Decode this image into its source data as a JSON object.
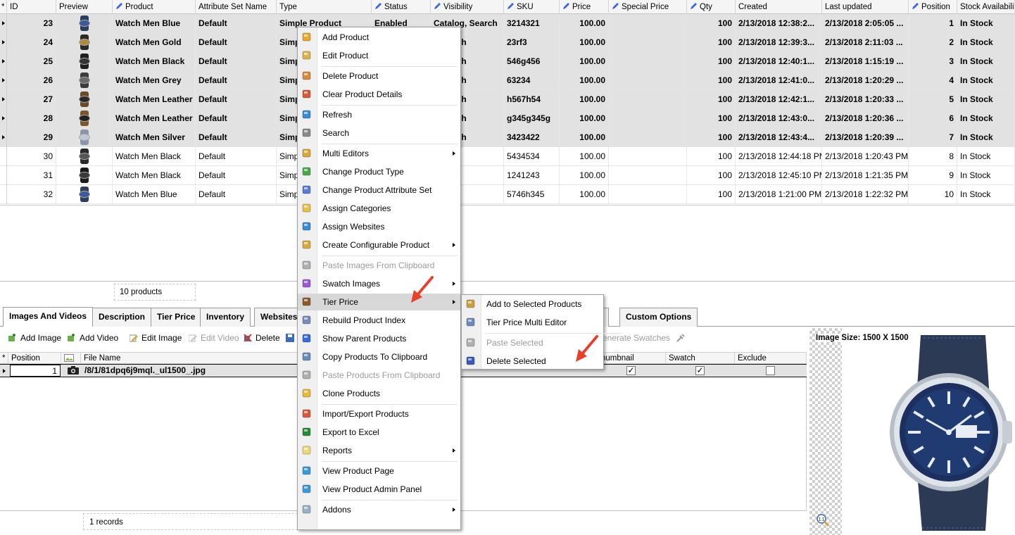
{
  "grid": {
    "columns": [
      {
        "label": "ID",
        "icon": "asterisk"
      },
      {
        "label": "Preview"
      },
      {
        "label": "Product",
        "icon": "pencil"
      },
      {
        "label": "Attribute Set Name"
      },
      {
        "label": "Type"
      },
      {
        "label": "Status",
        "icon": "pencil"
      },
      {
        "label": "Visibility",
        "icon": "pencil"
      },
      {
        "label": "SKU",
        "icon": "pencil"
      },
      {
        "label": "Price",
        "icon": "pencil"
      },
      {
        "label": "Special Price",
        "icon": "pencil"
      },
      {
        "label": "Qty",
        "icon": "pencil"
      },
      {
        "label": "Created"
      },
      {
        "label": "Last updated"
      },
      {
        "label": "Position",
        "icon": "pencil"
      },
      {
        "label": "Stock Availability"
      }
    ],
    "rows": [
      {
        "id": "23",
        "product": "Watch Men Blue",
        "attr": "Default",
        "type": "Simple Product",
        "status": "Enabled",
        "visibility": "Catalog, Search",
        "sku": "3214321",
        "price": "100.00",
        "special": "",
        "qty": "100",
        "created": "2/13/2018 12:38:2...",
        "updated": "2/13/2018 2:05:05 ...",
        "position": "1",
        "stock": "In Stock",
        "selected": true,
        "strap": "#2c3e5c",
        "face": "#3a5a9a"
      },
      {
        "id": "24",
        "product": "Watch Men Gold",
        "attr": "Default",
        "type": "Simp",
        "status": "",
        "visibility": ", Search",
        "sku": "23rf3",
        "price": "100.00",
        "special": "",
        "qty": "100",
        "created": "2/13/2018 12:39:3...",
        "updated": "2/13/2018 2:11:03 ...",
        "position": "2",
        "stock": "In Stock",
        "selected": true,
        "strap": "#2a2a2a",
        "face": "#b08a3e"
      },
      {
        "id": "25",
        "product": "Watch Men Black",
        "attr": "Default",
        "type": "Simp",
        "status": "",
        "visibility": ", Search",
        "sku": "546g456",
        "price": "100.00",
        "special": "",
        "qty": "100",
        "created": "2/13/2018 12:40:1...",
        "updated": "2/13/2018 1:15:19 ...",
        "position": "3",
        "stock": "In Stock",
        "selected": true,
        "strap": "#1e1e1e",
        "face": "#333333"
      },
      {
        "id": "26",
        "product": "Watch Men Grey",
        "attr": "Default",
        "type": "Simp",
        "status": "",
        "visibility": ", Search",
        "sku": "63234",
        "price": "100.00",
        "special": "",
        "qty": "100",
        "created": "2/13/2018 12:41:0...",
        "updated": "2/13/2018 1:20:29 ...",
        "position": "4",
        "stock": "In Stock",
        "selected": true,
        "strap": "#3b3b3b",
        "face": "#6a6a6a"
      },
      {
        "id": "27",
        "product": "Watch Men Leather",
        "attr": "Default",
        "type": "Simp",
        "status": "",
        "visibility": ", Search",
        "sku": "h567h54",
        "price": "100.00",
        "special": "",
        "qty": "100",
        "created": "2/13/2018 12:42:1...",
        "updated": "2/13/2018 1:20:33 ...",
        "position": "5",
        "stock": "In Stock",
        "selected": true,
        "strap": "#6b4a2a",
        "face": "#2a2a2a"
      },
      {
        "id": "28",
        "product": "Watch Men Leather",
        "attr": "Default",
        "type": "Simp",
        "status": "",
        "visibility": ", Search",
        "sku": "g345g345g",
        "price": "100.00",
        "special": "",
        "qty": "100",
        "created": "2/13/2018 12:43:0...",
        "updated": "2/13/2018 1:20:36 ...",
        "position": "6",
        "stock": "In Stock",
        "selected": true,
        "strap": "#7a5530",
        "face": "#222222"
      },
      {
        "id": "29",
        "product": "Watch Men Silver",
        "attr": "Default",
        "type": "Simp",
        "status": "",
        "visibility": ", Search",
        "sku": "3423422",
        "price": "100.00",
        "special": "",
        "qty": "100",
        "created": "2/13/2018 12:43:4...",
        "updated": "2/13/2018 1:20:39 ...",
        "position": "7",
        "stock": "In Stock",
        "selected": true,
        "strap": "#8a95a8",
        "face": "#c0c8d4"
      },
      {
        "id": "30",
        "product": "Watch Men Black",
        "attr": "Default",
        "type": "Simpl",
        "status": "",
        "visibility": "Search",
        "sku": "5434534",
        "price": "100.00",
        "special": "",
        "qty": "100",
        "created": "2/13/2018 12:44:18 PM",
        "updated": "2/13/2018 1:20:43 PM",
        "position": "8",
        "stock": "In Stock",
        "selected": false,
        "strap": "#2a2a2a",
        "face": "#555555"
      },
      {
        "id": "31",
        "product": "Watch Men Black",
        "attr": "Default",
        "type": "Simpl",
        "status": "",
        "visibility": "Search",
        "sku": "1241243",
        "price": "100.00",
        "special": "",
        "qty": "100",
        "created": "2/13/2018 12:45:10 PM",
        "updated": "2/13/2018 1:21:35 PM",
        "position": "9",
        "stock": "In Stock",
        "selected": false,
        "strap": "#1a1a1a",
        "face": "#3a3a3a"
      },
      {
        "id": "32",
        "product": "Watch Men Blue",
        "attr": "Default",
        "type": "Simpl",
        "status": "",
        "visibility": "Search",
        "sku": "5746h345",
        "price": "100.00",
        "special": "",
        "qty": "100",
        "created": "2/13/2018 1:21:00 PM",
        "updated": "2/13/2018 1:22:32 PM",
        "position": "10",
        "stock": "In Stock",
        "selected": false,
        "strap": "#2c3e5c",
        "face": "#3a5a9a"
      }
    ],
    "count_label": "10 products"
  },
  "tabs": [
    {
      "label": "Images And Videos",
      "active": true
    },
    {
      "label": "Description"
    },
    {
      "label": "Tier Price"
    },
    {
      "label": "Inventory"
    },
    {
      "label": "Websites"
    },
    {
      "label": "ws"
    },
    {
      "label": "Custom Options"
    }
  ],
  "toolbar": {
    "add_image": "Add Image",
    "add_video": "Add Video",
    "edit_image": "Edit Image",
    "edit_video": "Edit Video",
    "delete": "Delete",
    "generate_swatches": "enerate Swatches"
  },
  "subgrid": {
    "columns": [
      "Position",
      "",
      "File Name",
      "humbnail",
      "Swatch",
      "Exclude"
    ],
    "row": {
      "position": "1",
      "file": "/8/1/81dpq6j9mql._ul1500_.jpg"
    },
    "records_label": "1 records"
  },
  "preview": {
    "image_size": "Image Size: 1500 X 1500",
    "zoom_label": "1:1"
  },
  "context_menu": [
    {
      "label": "Add Product",
      "icon": "add-product-icon",
      "color": "#e8a82a"
    },
    {
      "label": "Edit Product",
      "icon": "edit-product-icon",
      "color": "#d8b44a"
    },
    {
      "sep": true
    },
    {
      "label": "Delete Product",
      "icon": "delete-product-icon",
      "color": "#d88a3a"
    },
    {
      "label": "Clear Product Details",
      "icon": "clear-details-icon",
      "color": "#d45a3a"
    },
    {
      "sep": true
    },
    {
      "label": "Refresh",
      "icon": "refresh-icon",
      "color": "#3a8ad8"
    },
    {
      "label": "Search",
      "icon": "search-icon",
      "color": "#8a8a8a"
    },
    {
      "sep": true
    },
    {
      "label": "Multi Editors",
      "icon": "multi-editors-icon",
      "color": "#d8a83a",
      "submenu": true
    },
    {
      "label": "Change Product Type",
      "icon": "change-type-icon",
      "color": "#4aa84a"
    },
    {
      "label": "Change Product Attribute Set",
      "icon": "attribute-set-icon",
      "color": "#5a7ad8"
    },
    {
      "label": "Assign Categories",
      "icon": "categories-icon",
      "color": "#e8c04a"
    },
    {
      "label": "Assign Websites",
      "icon": "websites-icon",
      "color": "#3a8ad8"
    },
    {
      "label": "Create Configurable Product",
      "icon": "configurable-icon",
      "color": "#d8a83a",
      "submenu": true
    },
    {
      "sep": true
    },
    {
      "label": "Paste Images From Clipboard",
      "icon": "paste-images-icon",
      "color": "#b0b0b0",
      "disabled": true
    },
    {
      "label": "Swatch Images",
      "icon": "swatch-icon",
      "color": "#9a5ad8",
      "submenu": true
    },
    {
      "label": "Tier Price",
      "icon": "tier-price-icon",
      "color": "#8a5a2a",
      "submenu": true,
      "highlighted": true
    },
    {
      "label": "Rebuild Product Index",
      "icon": "rebuild-index-icon",
      "color": "#7a8ab8"
    },
    {
      "label": "Show Parent Products",
      "icon": "parent-products-icon",
      "color": "#3a6ad8"
    },
    {
      "label": "Copy Products To Clipboard",
      "icon": "copy-icon",
      "color": "#6a8ab8"
    },
    {
      "label": "Paste Products From Clipboard",
      "icon": "paste-products-icon",
      "color": "#b0b0b0",
      "disabled": true
    },
    {
      "label": "Clone Products",
      "icon": "clone-icon",
      "color": "#e8b83a"
    },
    {
      "sep": true
    },
    {
      "label": "Import/Export Products",
      "icon": "import-export-icon",
      "color": "#d85a3a"
    },
    {
      "label": "Export to Excel",
      "icon": "excel-icon",
      "color": "#2a8a3a"
    },
    {
      "label": "Reports",
      "icon": "reports-icon",
      "color": "#e8d87a",
      "submenu": true
    },
    {
      "sep": true
    },
    {
      "label": "View Product Page",
      "icon": "globe-icon",
      "color": "#3a9ad8"
    },
    {
      "label": "View Product Admin Panel",
      "icon": "globe-icon",
      "color": "#3a9ad8"
    },
    {
      "sep": true
    },
    {
      "label": "Addons",
      "icon": "addons-icon",
      "color": "#9ab0c8",
      "submenu": true
    }
  ],
  "tier_submenu": [
    {
      "label": "Add to Selected Products",
      "icon": "add-tier-icon",
      "color": "#c8a040"
    },
    {
      "label": "Tier Price Multi Editor",
      "icon": "tier-editor-icon",
      "color": "#6a8ab8"
    },
    {
      "sep": true
    },
    {
      "label": "Paste Selected",
      "icon": "paste-tier-icon",
      "color": "#b0b0b0",
      "disabled": true
    },
    {
      "label": "Delete Selected",
      "icon": "delete-tier-icon",
      "color": "#3a5ab8"
    }
  ],
  "colors": {
    "selection": "#e2e2e2",
    "highlight": "#d8d8d8",
    "arrow": "#e8402a"
  }
}
